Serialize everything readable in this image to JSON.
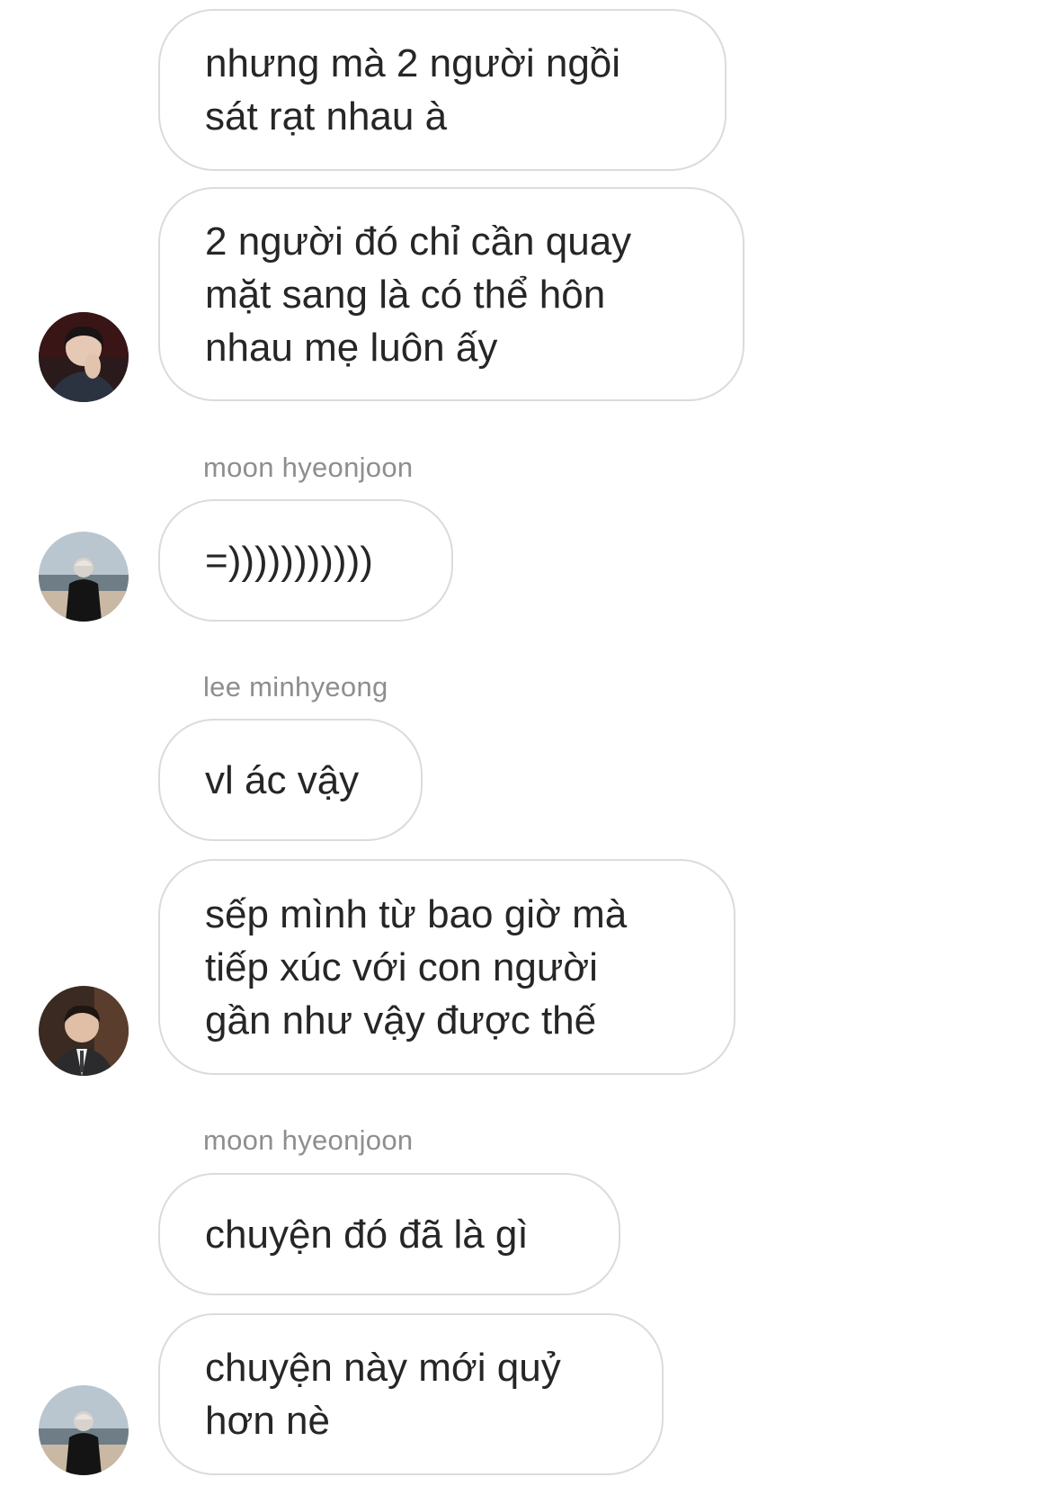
{
  "thread": {
    "messages": [
      {
        "text": "nhưng mà 2 người ngồi\nsát rạt nhau à"
      },
      {
        "text": "2 người đó chỉ cần quay\nmặt sang là có thể hôn\nnhau mẹ luôn ấy"
      },
      {
        "sender": "moon hyeonjoon"
      },
      {
        "text": "=)))))))))))"
      },
      {
        "sender": "lee minhyeong"
      },
      {
        "text": "vl ác vậy"
      },
      {
        "text": "sếp mình từ bao giờ mà\ntiếp xúc với con người\ngần như vậy được thế"
      },
      {
        "sender": "moon hyeonjoon"
      },
      {
        "text": "chuyện đó đã là gì"
      },
      {
        "text": "chuyện này mới quỷ\nhơn nè"
      }
    ]
  },
  "avatars": [
    {
      "icon": "profile-photo-icon"
    },
    {
      "icon": "profile-photo-icon"
    },
    {
      "icon": "profile-photo-icon"
    },
    {
      "icon": "profile-photo-icon"
    }
  ],
  "colors": {
    "bubble_border": "#dbdbdb",
    "text": "#262626",
    "sender_text": "#8e8e8e",
    "background": "#ffffff"
  }
}
